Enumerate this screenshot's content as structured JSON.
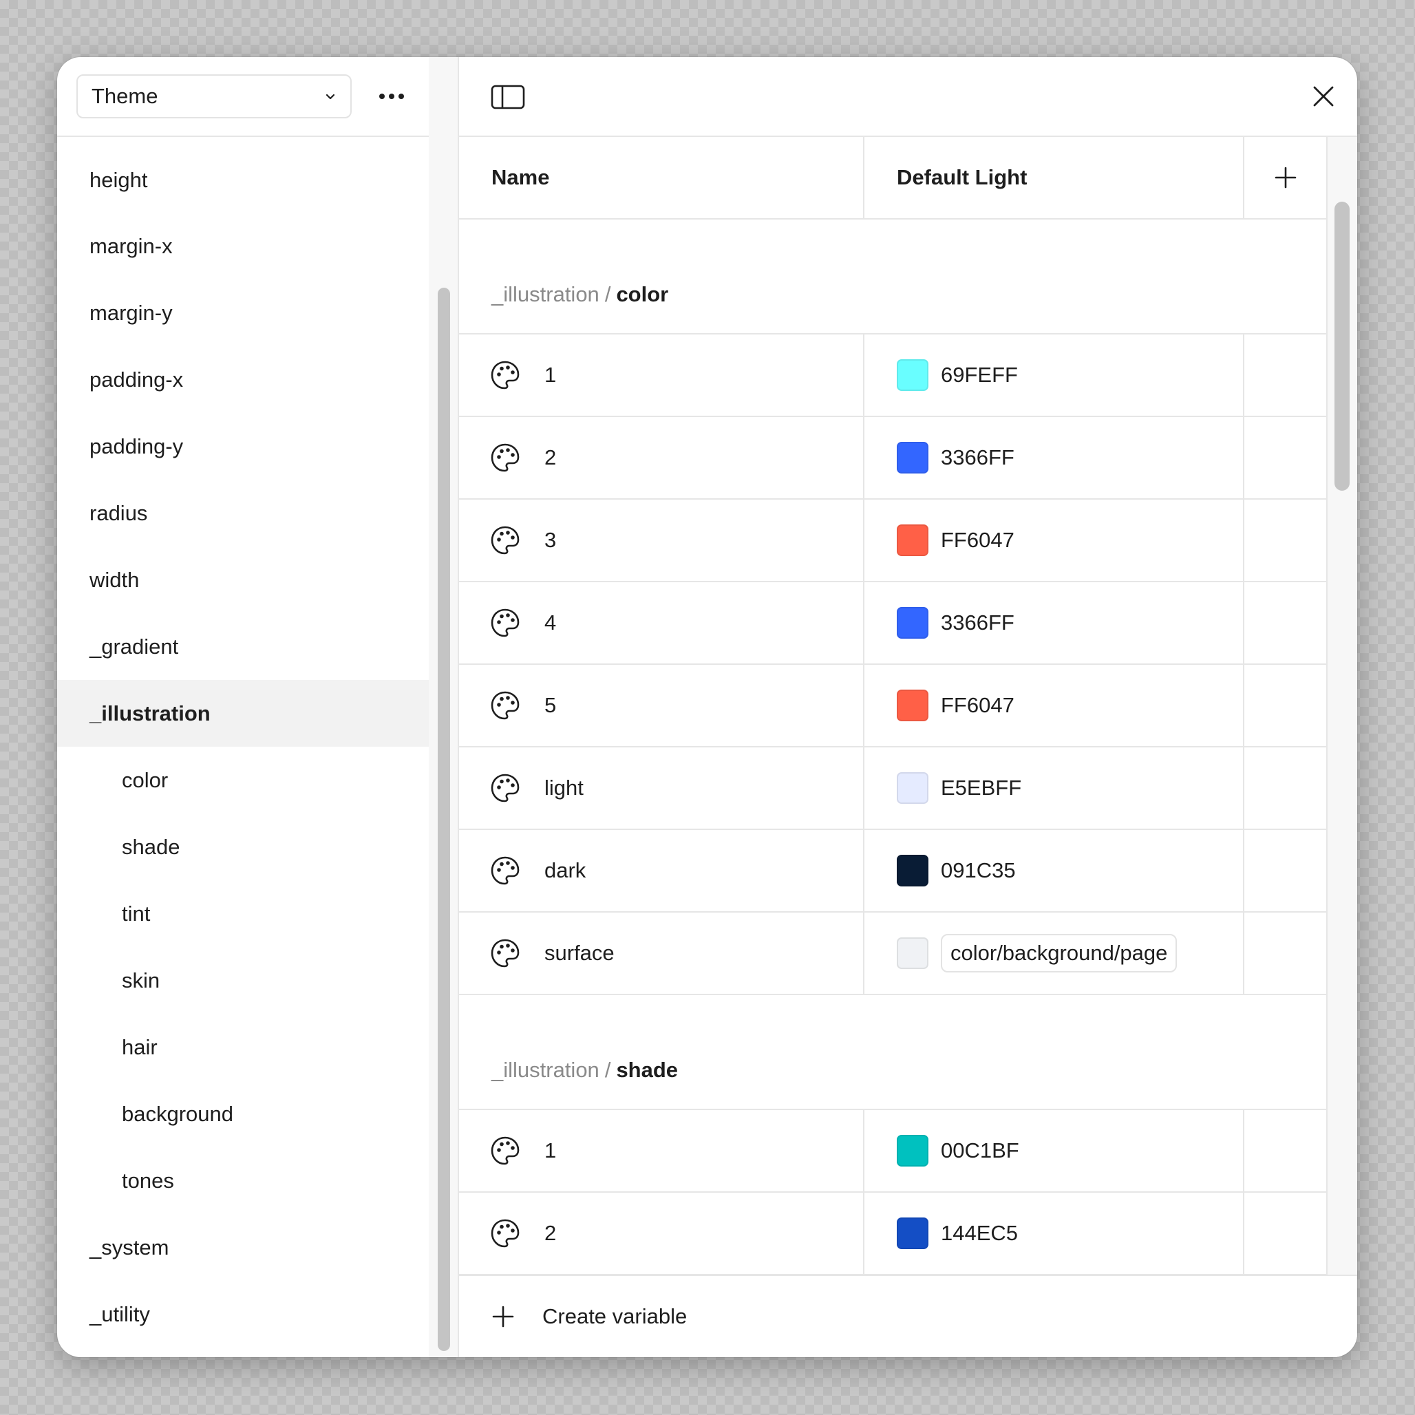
{
  "sidebar": {
    "select_value": "Theme",
    "items": [
      {
        "label": "height",
        "level": 0,
        "active": false
      },
      {
        "label": "margin-x",
        "level": 0,
        "active": false
      },
      {
        "label": "margin-y",
        "level": 0,
        "active": false
      },
      {
        "label": "padding-x",
        "level": 0,
        "active": false
      },
      {
        "label": "padding-y",
        "level": 0,
        "active": false
      },
      {
        "label": "radius",
        "level": 0,
        "active": false
      },
      {
        "label": "width",
        "level": 0,
        "active": false
      },
      {
        "label": "_gradient",
        "level": 0,
        "active": false
      },
      {
        "label": "_illustration",
        "level": 0,
        "active": true
      },
      {
        "label": "color",
        "level": 1,
        "active": false
      },
      {
        "label": "shade",
        "level": 1,
        "active": false
      },
      {
        "label": "tint",
        "level": 1,
        "active": false
      },
      {
        "label": "skin",
        "level": 1,
        "active": false
      },
      {
        "label": "hair",
        "level": 1,
        "active": false
      },
      {
        "label": "background",
        "level": 1,
        "active": false
      },
      {
        "label": "tones",
        "level": 1,
        "active": false
      },
      {
        "label": "_system",
        "level": 0,
        "active": false
      },
      {
        "label": "_utility",
        "level": 0,
        "active": false
      }
    ]
  },
  "table": {
    "columns": {
      "name": "Name",
      "mode": "Default Light"
    },
    "groups": [
      {
        "prefix": "_illustration",
        "separator": "/",
        "leaf": "color",
        "rows": [
          {
            "name": "1",
            "swatch": "#69FEFF",
            "value": "69FEFF",
            "alias": false
          },
          {
            "name": "2",
            "swatch": "#3366FF",
            "value": "3366FF",
            "alias": false
          },
          {
            "name": "3",
            "swatch": "#FF6047",
            "value": "FF6047",
            "alias": false
          },
          {
            "name": "4",
            "swatch": "#3366FF",
            "value": "3366FF",
            "alias": false
          },
          {
            "name": "5",
            "swatch": "#FF6047",
            "value": "FF6047",
            "alias": false
          },
          {
            "name": "light",
            "swatch": "#E5EBFF",
            "value": "E5EBFF",
            "alias": false
          },
          {
            "name": "dark",
            "swatch": "#091C35",
            "value": "091C35",
            "alias": false
          },
          {
            "name": "surface",
            "swatch": "#F0F2F5",
            "value": "color/background/page",
            "alias": true
          }
        ]
      },
      {
        "prefix": "_illustration",
        "separator": "/",
        "leaf": "shade",
        "rows": [
          {
            "name": "1",
            "swatch": "#00C1BF",
            "value": "00C1BF",
            "alias": false
          },
          {
            "name": "2",
            "swatch": "#144EC5",
            "value": "144EC5",
            "alias": false
          }
        ]
      }
    ]
  },
  "footer": {
    "create_label": "Create variable"
  },
  "icons": {
    "chevron": "chevron-down-icon",
    "more": "more-horizontal-icon",
    "panel": "sidebar-toggle-icon",
    "close": "close-icon",
    "add": "plus-icon",
    "variable": "palette-icon"
  }
}
